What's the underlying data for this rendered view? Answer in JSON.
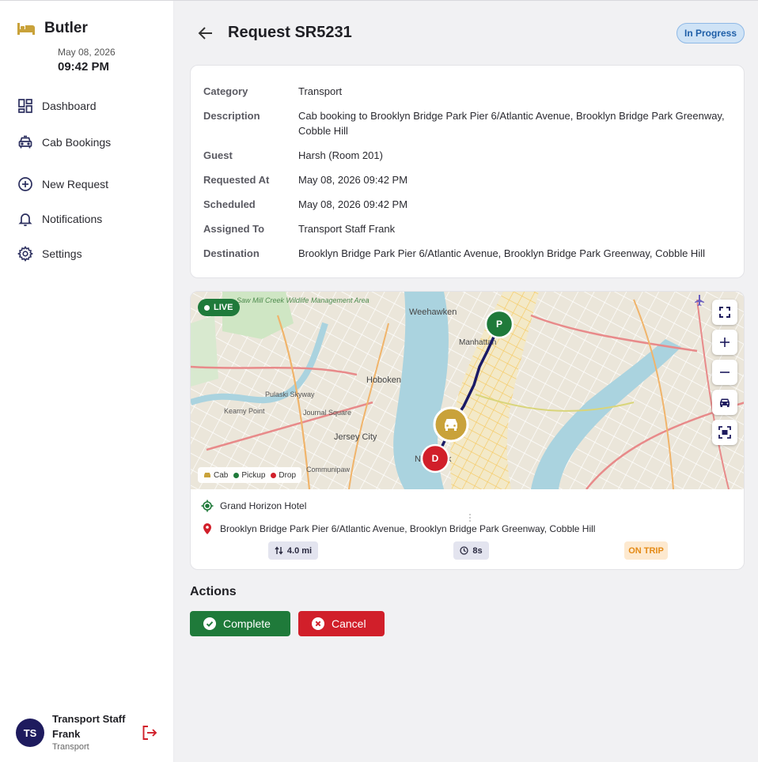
{
  "app": {
    "name": "Butler",
    "date": "May 08, 2026",
    "time": "09:42 PM"
  },
  "nav": {
    "items": [
      {
        "label": "Dashboard",
        "icon": "dashboard-icon"
      },
      {
        "label": "Cab Bookings",
        "icon": "car-icon"
      },
      {
        "label": "New Request",
        "icon": "plus-circle-icon"
      },
      {
        "label": "Notifications",
        "icon": "bell-icon"
      },
      {
        "label": "Settings",
        "icon": "gear-icon"
      }
    ]
  },
  "user": {
    "initials": "TS",
    "name": "Transport Staff Frank",
    "role": "Transport"
  },
  "header": {
    "title": "Request SR5231",
    "status": "In Progress"
  },
  "details": {
    "rows": [
      {
        "label": "Category",
        "value": "Transport"
      },
      {
        "label": "Description",
        "value": "Cab booking to Brooklyn Bridge Park Pier 6/Atlantic Avenue, Brooklyn Bridge Park Greenway, Cobble Hill"
      },
      {
        "label": "Guest",
        "value": "Harsh (Room 201)"
      },
      {
        "label": "Requested At",
        "value": "May 08, 2026 09:42 PM"
      },
      {
        "label": "Scheduled",
        "value": "May 08, 2026 09:42 PM"
      },
      {
        "label": "Assigned To",
        "value": "Transport Staff Frank"
      },
      {
        "label": "Destination",
        "value": "Brooklyn Bridge Park Pier 6/Atlantic Avenue, Brooklyn Bridge Park Greenway, Cobble Hill"
      }
    ]
  },
  "map": {
    "live_label": "LIVE",
    "place_labels": [
      "Weehawken",
      "Manhattan",
      "Hoboken",
      "Jersey City",
      "Journal Square",
      "Pulaski Skyway",
      "Kearny Point",
      "Communipaw",
      "Saw Mill Creek Wildlife Management Area",
      "New York"
    ],
    "pickup_marker": "P",
    "drop_marker": "D",
    "legend": {
      "cab": "Cab",
      "pickup": "Pickup",
      "drop": "Drop"
    },
    "colors": {
      "pickup": "#1f7a3a",
      "drop": "#d11f2a",
      "cab": "#c9a23a",
      "route": "#1a1a66"
    }
  },
  "trip": {
    "origin": "Grand Horizon Hotel",
    "destination": "Brooklyn Bridge Park Pier 6/Atlantic Avenue, Brooklyn Bridge Park Greenway, Cobble Hill",
    "distance": "4.0 mi",
    "eta": "8s",
    "status": "ON TRIP"
  },
  "actions": {
    "title": "Actions",
    "complete_label": "Complete",
    "cancel_label": "Cancel"
  }
}
